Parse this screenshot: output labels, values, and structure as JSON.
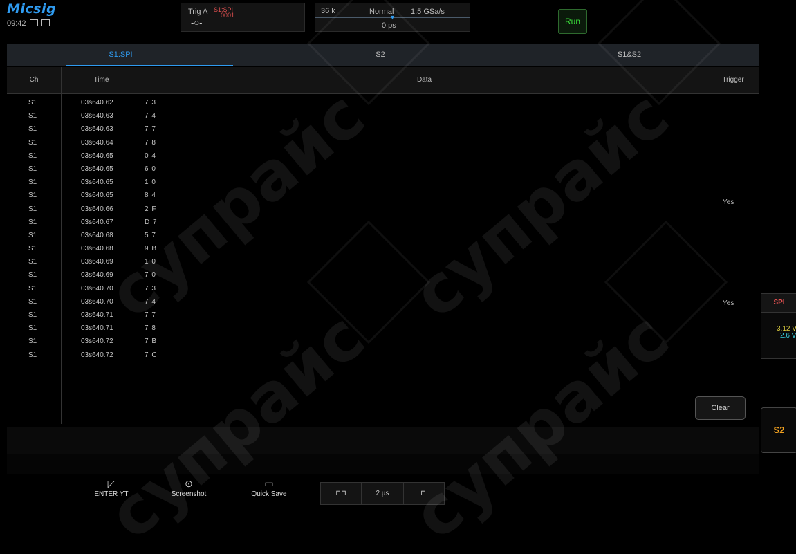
{
  "header": {
    "logo": "Micsig",
    "clock": "09:42",
    "trigger": {
      "label": "Trig A",
      "source": "S1:SPI",
      "value": "0001",
      "symbol": "-○-"
    },
    "acquisition": {
      "memory": "36 k",
      "mode": "Normal",
      "sample_rate": "1.5 GSa/s",
      "delay": "0 ps"
    },
    "run_label": "Run"
  },
  "tabs": [
    {
      "label": "S1:SPI"
    },
    {
      "label": "S2"
    },
    {
      "label": "S1&S2"
    }
  ],
  "table": {
    "headers": {
      "ch": "Ch",
      "time": "Time",
      "data": "Data",
      "trigger": "Trigger"
    },
    "rows": [
      {
        "ch": "S1",
        "time": "03s640.62",
        "data": "7 3"
      },
      {
        "ch": "S1",
        "time": "03s640.63",
        "data": "7 4"
      },
      {
        "ch": "S1",
        "time": "03s640.63",
        "data": "7 7"
      },
      {
        "ch": "S1",
        "time": "03s640.64",
        "data": "7 8"
      },
      {
        "ch": "S1",
        "time": "03s640.65",
        "data": "0 4"
      },
      {
        "ch": "S1",
        "time": "03s640.65",
        "data": "6 0"
      },
      {
        "ch": "S1",
        "time": "03s640.65",
        "data": "1 0"
      },
      {
        "ch": "S1",
        "time": "03s640.65",
        "data": "8 4"
      },
      {
        "ch": "S1",
        "time": "03s640.66",
        "data": "2 F"
      },
      {
        "ch": "S1",
        "time": "03s640.67",
        "data": "D 7"
      },
      {
        "ch": "S1",
        "time": "03s640.68",
        "data": "5 7"
      },
      {
        "ch": "S1",
        "time": "03s640.68",
        "data": "9 B"
      },
      {
        "ch": "S1",
        "time": "03s640.69",
        "data": "1 0"
      },
      {
        "ch": "S1",
        "time": "03s640.69",
        "data": "7 0"
      },
      {
        "ch": "S1",
        "time": "03s640.70",
        "data": "7 3"
      },
      {
        "ch": "S1",
        "time": "03s640.70",
        "data": "7 4"
      },
      {
        "ch": "S1",
        "time": "03s640.71",
        "data": "7 7"
      },
      {
        "ch": "S1",
        "time": "03s640.71",
        "data": "7 8"
      },
      {
        "ch": "S1",
        "time": "03s640.72",
        "data": "7 B"
      },
      {
        "ch": "S1",
        "time": "03s640.72",
        "data": "7 C"
      }
    ],
    "trigger_marks": [
      "Yes",
      "Yes"
    ]
  },
  "clear_label": "Clear",
  "side": {
    "protocol": "SPI",
    "v1": "3.12 V",
    "v2": "2.6 V",
    "bus_label": "S2"
  },
  "toolbar": {
    "enter_yt": "ENTER YT",
    "screenshot": "Screenshot",
    "quick_save": "Quick Save",
    "timebase": "2 µs"
  },
  "watermark": "супрайс",
  "colors": {
    "accent": "#2f9bf0",
    "run": "#3ae03a",
    "trigger_red": "#e05050",
    "bus_orange": "#f0a020"
  }
}
